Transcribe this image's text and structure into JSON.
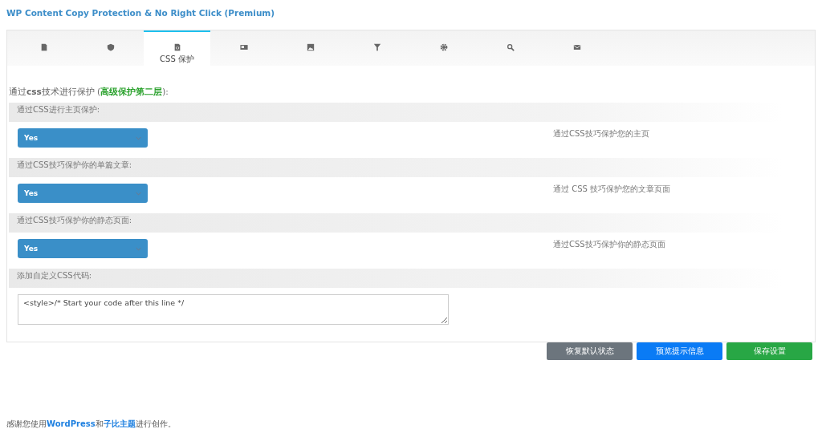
{
  "title": "WP Content Copy Protection & No Right Click (Premium)",
  "tabs": [
    {
      "selected": false
    },
    {
      "selected": false
    },
    {
      "label": "CSS 保护",
      "selected": true
    },
    {
      "selected": false
    },
    {
      "selected": false
    },
    {
      "selected": false
    },
    {
      "selected": false
    },
    {
      "selected": false
    },
    {
      "selected": false
    }
  ],
  "heading": {
    "before": "通过**css**技术进行保护 (",
    "highlight": "高级保护第二层",
    "after": "):"
  },
  "settings": [
    {
      "label": "通过CSS进行主页保护:",
      "value": "Yes",
      "description": "通过CSS技巧保护您的主页"
    },
    {
      "label": "通过CSS技巧保护你的单篇文章:",
      "value": "Yes",
      "description": "通过 CSS 技巧保护您的文章页面"
    },
    {
      "label": "通过CSS技巧保护你的静态页面:",
      "value": "Yes",
      "description": "通过CSS技巧保护你的静态页面"
    }
  ],
  "custom_css": {
    "label": "添加自定义CSS代码:",
    "value": "<style>/* Start your code after this line */"
  },
  "buttons": [
    {
      "label": "恢复默认状态",
      "kind": "reset"
    },
    {
      "label": "预览提示信息",
      "kind": "preview"
    },
    {
      "label": "保存设置",
      "kind": "save"
    }
  ],
  "footer": {
    "before": "感谢您使用",
    "link1": "WordPress",
    "middle": "和",
    "link2": "子比主题",
    "after": "进行创作。"
  }
}
